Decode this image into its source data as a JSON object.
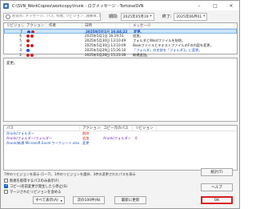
{
  "window": {
    "title": "C:\\SVN_WorkCopies\\workcopy\\trunk - ログメッセージ - TortoiseSVN",
    "controls": [
      "–",
      "□",
      "×"
    ]
  },
  "toolbar": {
    "search_placeholder": "お気作: メッセージ、パス, 作者, リビジョン, 課番目, 日付, 日付",
    "from_label": "期間:",
    "from_date": "2025年05月19",
    "to_label": "終了:",
    "to_date": "2025年06月01"
  },
  "log_table": {
    "headers": [
      "リビジョン",
      "アクション",
      "作者",
      "日時",
      "メッセージ"
    ],
    "rows": [
      {
        "rev": "7",
        "marks": [
          "blue",
          "red"
        ],
        "date": "2025年5月1日 16:44:22",
        "msg": "変更。",
        "selected": true
      },
      {
        "rev": "6",
        "marks": [
          "red",
          "red"
        ],
        "date": "2025年5月1日 16:19:51",
        "msg": "追加。",
        "selected": false
      },
      {
        "rev": "5",
        "marks": [
          "red"
        ],
        "date": "2025年5月30日 13:10:49",
        "msg": "フォルダとWordファイルを削除。",
        "selected": false
      },
      {
        "rev": "4",
        "marks": [
          "red",
          "red"
        ],
        "date": "2025年5月30日 13:10:09",
        "msg": "BookファイルとテキストファイルのFの内容を変更。",
        "selected": false
      },
      {
        "rev": "3",
        "marks": [
          "blue"
        ],
        "date": "2025年5月29日 15:26:10",
        "msg": "「フォルダ」の名前を「フォルダ1」に変更。",
        "selected": false
      },
      {
        "rev": "2",
        "marks": [
          "red",
          "red"
        ],
        "date": "2025年5月28日 15:23:30",
        "msg": "新規追加。",
        "selected": false
      },
      {
        "rev": "1",
        "marks": [
          "blue"
        ],
        "date": "2025年5月28日 15:15:18",
        "msg": "フォルダ構造をインポート",
        "selected": false
      }
    ]
  },
  "message_box": {
    "text": "変更。"
  },
  "paths_table": {
    "headers": [
      "パス",
      "アクション",
      "コピー元のパス",
      "リビジョン"
    ],
    "rows": [
      {
        "path": "/trunk/フォルダー",
        "action": "削除",
        "src": "",
        "srev": "",
        "type": "del"
      },
      {
        "path": "/trunk/フォルダー/フォルダー",
        "action": "追加",
        "src": "/trunk/フォルダー",
        "srev": "6",
        "type": "add"
      },
      {
        "path": "/trunk/新規 Microsoft Excel ワークシート.xlsx",
        "action": "変更",
        "src": "",
        "srev": "",
        "type": "mod"
      }
    ]
  },
  "status": {
    "text": "7件のリビジョンを表示 (1〜7)、1件のリビジョンを選択、3件の変更されたパスを表示"
  },
  "options": [
    {
      "label": "新規を取得するパスのみ表示(F)",
      "checked": false
    },
    {
      "label": "コピー/名前変更が発生したら停止(S)",
      "checked": true
    },
    {
      "label": "マージされたリビジョンを含める",
      "checked": false
    }
  ],
  "buttons": {
    "statistics": "統計(T)",
    "help": "ヘルプ",
    "show_all": "すべて表示(A)",
    "next_100": "次の100件(N)",
    "refresh": "最新に更新",
    "ok": "OK"
  },
  "colors": {
    "selection_bg": "#cce4f7",
    "ok_border": "#d82020",
    "link_blue": "#1a4fb8"
  }
}
